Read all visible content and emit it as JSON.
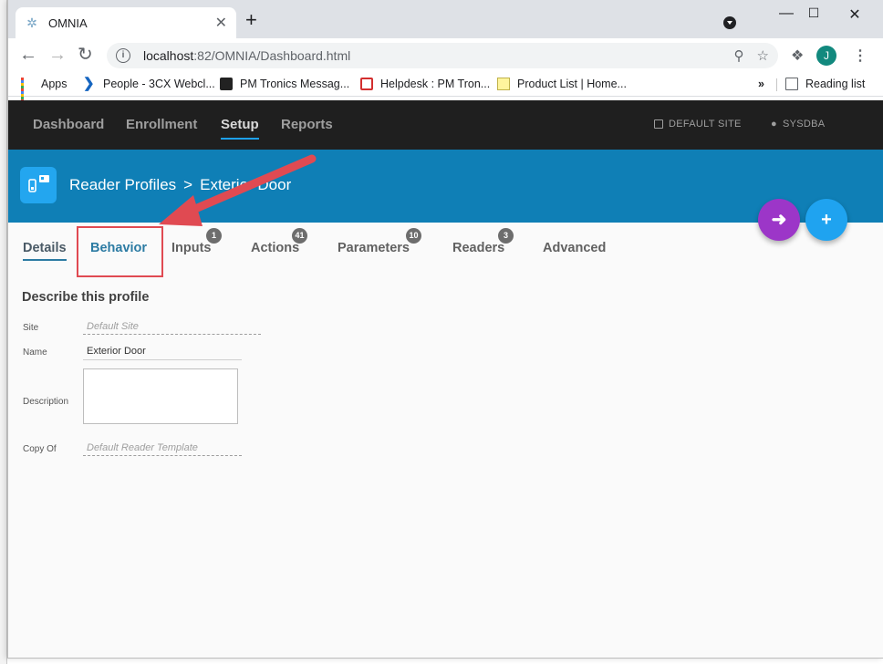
{
  "browser": {
    "tab_title": "OMNIA",
    "tab_close": "✕",
    "new_tab": "+",
    "url_host": "localhost",
    "url_path": ":82/OMNIA/Dashboard.html",
    "avatar_initial": "J",
    "bookmarks": [
      {
        "label": "Apps",
        "icon": "apps-grid-icon"
      },
      {
        "label": "People - 3CX Webcl...",
        "icon": "3cx-icon"
      },
      {
        "label": "PM Tronics Messag...",
        "icon": "messaging-icon"
      },
      {
        "label": "Helpdesk : PM Tron...",
        "icon": "helpdesk-icon"
      },
      {
        "label": "Product List | Home...",
        "icon": "note-icon"
      }
    ],
    "overflow": "»",
    "reading_list": "Reading list"
  },
  "nav": {
    "items": [
      "Dashboard",
      "Enrollment",
      "Setup",
      "Reports"
    ],
    "active": "Setup",
    "site": "DEFAULT SITE",
    "user": "SYSDBA"
  },
  "header": {
    "crumb_parent": "Reader Profiles",
    "crumb_sep": ">",
    "crumb_current": "Exterior Door"
  },
  "fabs": {
    "back_glyph": "🡐",
    "add_glyph": "+"
  },
  "tabs": [
    {
      "label": "Details",
      "badge": ""
    },
    {
      "label": "Behavior",
      "badge": ""
    },
    {
      "label": "Inputs",
      "badge": "1"
    },
    {
      "label": "Actions",
      "badge": "41"
    },
    {
      "label": "Parameters",
      "badge": "10"
    },
    {
      "label": "Readers",
      "badge": "3"
    },
    {
      "label": "Advanced",
      "badge": ""
    }
  ],
  "form": {
    "heading": "Describe this profile",
    "site_label": "Site",
    "site_value": "Default Site",
    "name_label": "Name",
    "name_value": "Exterior Door",
    "description_label": "Description",
    "description_value": "",
    "copy_label": "Copy Of",
    "copy_value": "Default Reader Template"
  },
  "colors": {
    "header_blue": "#0f7fb6",
    "back_fab": "#9c36c8",
    "add_fab": "#1fa3f0",
    "annotation_red": "#e04a52"
  }
}
